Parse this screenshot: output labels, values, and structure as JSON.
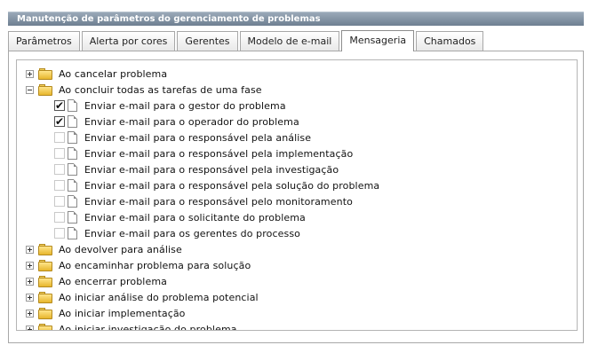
{
  "window": {
    "title": "Manutenção de parâmetros do gerenciamento de problemas"
  },
  "tabs": [
    {
      "label": "Parâmetros",
      "active": false
    },
    {
      "label": "Alerta por cores",
      "active": false
    },
    {
      "label": "Gerentes",
      "active": false
    },
    {
      "label": "Modelo de e-mail",
      "active": false
    },
    {
      "label": "Mensageria",
      "active": true
    },
    {
      "label": "Chamados",
      "active": false
    }
  ],
  "tree": {
    "groups": [
      {
        "label": "Ao cancelar problema",
        "expanded": false
      },
      {
        "label": "Ao concluir todas as tarefas de uma fase",
        "expanded": true
      },
      {
        "label": "Ao devolver para análise",
        "expanded": false
      },
      {
        "label": "Ao encaminhar problema para solução",
        "expanded": false
      },
      {
        "label": "Ao encerrar problema",
        "expanded": false
      },
      {
        "label": "Ao iniciar análise do problema potencial",
        "expanded": false
      },
      {
        "label": "Ao iniciar implementação",
        "expanded": false
      },
      {
        "label": "Ao iniciar investigação do problema",
        "expanded": false
      }
    ],
    "expanded_items": [
      {
        "label": "Enviar e-mail para o gestor do problema",
        "checked": true
      },
      {
        "label": "Enviar e-mail para o operador do problema",
        "checked": true
      },
      {
        "label": "Enviar e-mail para o responsável pela análise",
        "checked": false
      },
      {
        "label": "Enviar e-mail para o responsável pela implementação",
        "checked": false
      },
      {
        "label": "Enviar e-mail para o responsável pela investigação",
        "checked": false
      },
      {
        "label": "Enviar e-mail para o responsável pela solução do problema",
        "checked": false
      },
      {
        "label": "Enviar e-mail para o responsável pelo monitoramento",
        "checked": false
      },
      {
        "label": "Enviar e-mail para o solicitante do problema",
        "checked": false
      },
      {
        "label": "Enviar e-mail para os gerentes do processo",
        "checked": false
      }
    ]
  },
  "icons": {
    "expand": "plus-expander-icon",
    "collapse": "minus-expander-icon",
    "folder": "folder-icon",
    "document": "document-icon",
    "check": "✔"
  },
  "colors": {
    "titlebar": "#7b8b9c",
    "folder": "#f0c64a"
  }
}
